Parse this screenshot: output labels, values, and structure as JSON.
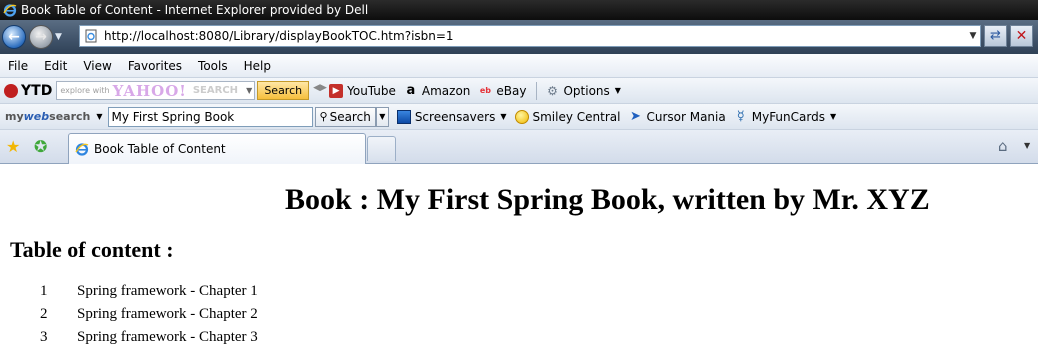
{
  "window": {
    "title": "Book Table of Content - Internet Explorer provided by Dell"
  },
  "address_bar": {
    "url": "http://localhost:8080/Library/displayBookTOC.htm?isbn=1"
  },
  "menu": [
    "File",
    "Edit",
    "View",
    "Favorites",
    "Tools",
    "Help"
  ],
  "toolbar_ytd": {
    "logo": "YTD",
    "search_placeholder": "explore with",
    "search_brand": "YAHOO!",
    "search_suffix": "SEARCH",
    "search_button": "Search",
    "items": [
      "YouTube",
      "Amazon",
      "eBay"
    ],
    "options_label": "Options"
  },
  "toolbar_mywebsearch": {
    "logo_my": "my",
    "logo_web": "web",
    "logo_search": "search",
    "search_value": "My First Spring Book",
    "search_button": "Search",
    "items": [
      "Screensavers",
      "Smiley Central",
      "Cursor Mania",
      "MyFunCards"
    ]
  },
  "tabs": [
    {
      "label": "Book Table of Content",
      "active": true
    }
  ],
  "page": {
    "book_title": "Book : My First Spring Book, written by Mr. XYZ",
    "toc_heading": "Table of content :",
    "toc": [
      {
        "num": "1",
        "title": "Spring framework - Chapter 1"
      },
      {
        "num": "2",
        "title": "Spring framework - Chapter 2"
      },
      {
        "num": "3",
        "title": "Spring framework - Chapter 3"
      }
    ]
  },
  "colors": {
    "titlebar_bg": "#111111",
    "address_bar_bg": "#3f5269",
    "ytd_search_button": "#f6bf3c"
  }
}
